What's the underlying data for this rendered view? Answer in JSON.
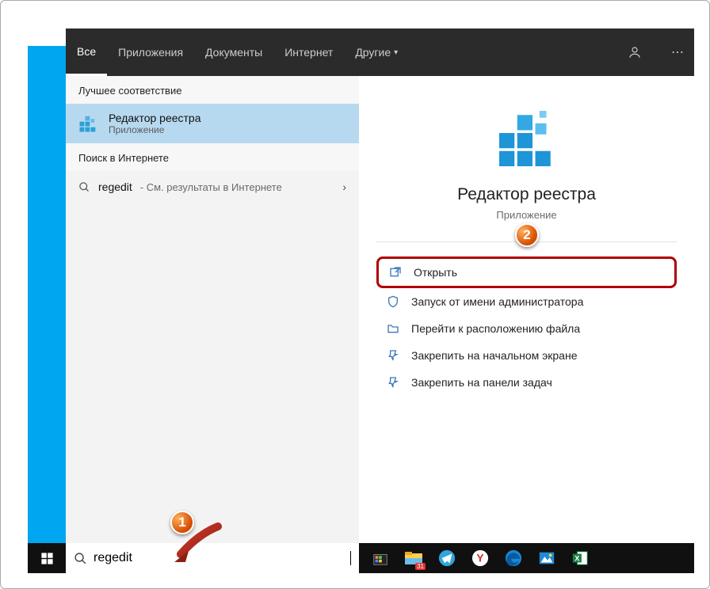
{
  "header": {
    "tabs": [
      "Все",
      "Приложения",
      "Документы",
      "Интернет",
      "Другие"
    ],
    "active_index": 0
  },
  "results": {
    "best_match_label": "Лучшее соответствие",
    "best_match": {
      "title": "Редактор реестра",
      "subtitle": "Приложение"
    },
    "web_label": "Поиск в Интернете",
    "web_query": "regedit",
    "web_hint": " - См. результаты в Интернете"
  },
  "detail": {
    "title": "Редактор реестра",
    "subtitle": "Приложение",
    "actions": [
      {
        "icon": "open-icon",
        "label": "Открыть",
        "highlight": true
      },
      {
        "icon": "shield-icon",
        "label": "Запуск от имени администратора"
      },
      {
        "icon": "folder-icon",
        "label": "Перейти к расположению файла"
      },
      {
        "icon": "pin-icon",
        "label": "Закрепить на начальном экране"
      },
      {
        "icon": "pin-icon",
        "label": "Закрепить на панели задач"
      }
    ]
  },
  "search": {
    "value": "regedit"
  },
  "annotations": {
    "badge1": "1",
    "badge2": "2"
  },
  "taskbar_icons": [
    "store-icon",
    "explorer-icon",
    "telegram-icon",
    "yandex-icon",
    "edge-icon",
    "photos-icon",
    "excel-icon"
  ]
}
